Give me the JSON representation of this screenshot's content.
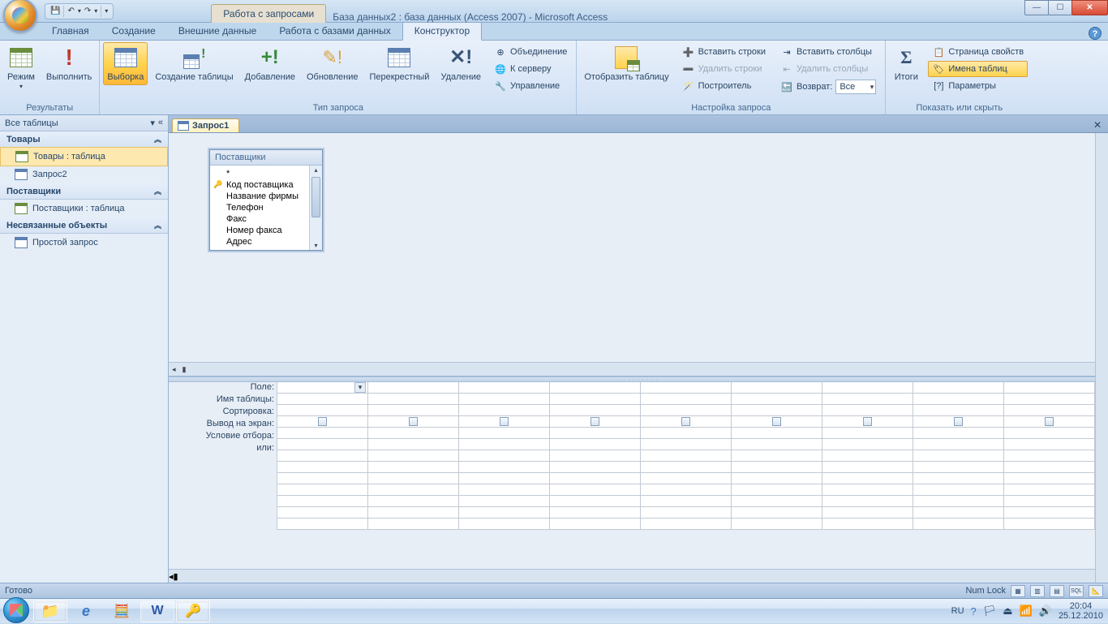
{
  "title": {
    "context_tab": "Работа с запросами",
    "doc": "База данных2 : база данных (Access 2007) - Microsoft Access"
  },
  "ribbon": {
    "tabs": [
      "Главная",
      "Создание",
      "Внешние данные",
      "Работа с базами данных",
      "Конструктор"
    ],
    "active": 4,
    "g_results": {
      "label": "Результаты",
      "view": "Режим",
      "run": "Выполнить"
    },
    "g_type": {
      "label": "Тип запроса",
      "select": "Выборка",
      "make": "Создание таблицы",
      "append": "Добавление",
      "update": "Обновление",
      "crosstab": "Перекрестный",
      "delete": "Удаление",
      "union": "Объединение",
      "passthrough": "К серверу",
      "datadef": "Управление"
    },
    "g_setup": {
      "label": "Настройка запроса",
      "show_table": "Отобразить таблицу",
      "ins_rows": "Вставить строки",
      "del_rows": "Удалить строки",
      "builder": "Построитель",
      "ins_cols": "Вставить столбцы",
      "del_cols": "Удалить столбцы",
      "return": "Возврат:",
      "return_val": "Все"
    },
    "g_show": {
      "label": "Показать или скрыть",
      "totals": "Итоги",
      "propsheet": "Страница свойств",
      "tblnames": "Имена таблиц",
      "params": "Параметры"
    }
  },
  "nav": {
    "title": "Все таблицы",
    "groups": [
      {
        "name": "Товары",
        "items": [
          {
            "label": "Товары : таблица",
            "kind": "table",
            "sel": true
          },
          {
            "label": "Запрос2",
            "kind": "query"
          }
        ]
      },
      {
        "name": "Поставщики",
        "items": [
          {
            "label": "Поставщики : таблица",
            "kind": "table"
          }
        ]
      },
      {
        "name": "Несвязанные объекты",
        "items": [
          {
            "label": "Простой запрос",
            "kind": "query"
          }
        ]
      }
    ]
  },
  "doc_tab": "Запрос1",
  "tbl_box": {
    "title": "Поставщики",
    "fields": [
      "*",
      "Код поставщика",
      "Название фирмы",
      "Телефон",
      "Факс",
      "Номер факса",
      "Адрес"
    ],
    "key_index": 1
  },
  "qgrid": {
    "rows": [
      "Поле:",
      "Имя таблицы:",
      "Сортировка:",
      "Вывод на экран:",
      "Условие отбора:",
      "или:"
    ]
  },
  "status": {
    "left": "Готово",
    "numlock": "Num Lock"
  },
  "taskbar": {
    "lang": "RU",
    "time": "20:04",
    "date": "25.12.2010"
  }
}
